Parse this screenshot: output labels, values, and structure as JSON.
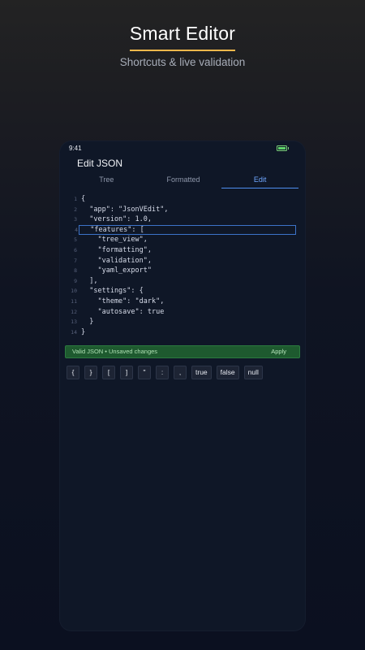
{
  "hero": {
    "title": "Smart Editor",
    "subtitle": "Shortcuts & live validation"
  },
  "colors": {
    "accent_underline": "#f2b84b",
    "active_tab": "#6fa7ff",
    "valid_bar": "#1e5a2f",
    "battery": "#5fd36a"
  },
  "device": {
    "status_time": "9:41",
    "battery_icon": "battery-full-icon",
    "app_title": "Edit JSON",
    "tabs": [
      {
        "label": "Tree",
        "active": false
      },
      {
        "label": "Formatted",
        "active": false
      },
      {
        "label": "Edit",
        "active": true
      }
    ],
    "editor": {
      "current_line": 4,
      "lines": [
        {
          "num": "1",
          "text": "{"
        },
        {
          "num": "2",
          "text": "  \"app\": \"JsonVEdit\","
        },
        {
          "num": "3",
          "text": "  \"version\": 1.0,"
        },
        {
          "num": "4",
          "text": "  \"features\": ["
        },
        {
          "num": "5",
          "text": "    \"tree_view\","
        },
        {
          "num": "6",
          "text": "    \"formatting\","
        },
        {
          "num": "7",
          "text": "    \"validation\","
        },
        {
          "num": "8",
          "text": "    \"yaml_export\""
        },
        {
          "num": "9",
          "text": "  ],"
        },
        {
          "num": "10",
          "text": "  \"settings\": {"
        },
        {
          "num": "11",
          "text": "    \"theme\": \"dark\","
        },
        {
          "num": "12",
          "text": "    \"autosave\": true"
        },
        {
          "num": "13",
          "text": "  }"
        },
        {
          "num": "14",
          "text": "}"
        }
      ]
    },
    "validation": {
      "status_text": "Valid JSON  •  Unsaved changes",
      "apply_label": "Apply"
    },
    "shortcut_keys": [
      "{",
      "}",
      "[",
      "]",
      "\"",
      ":",
      ",",
      "true",
      "false",
      "null"
    ]
  }
}
